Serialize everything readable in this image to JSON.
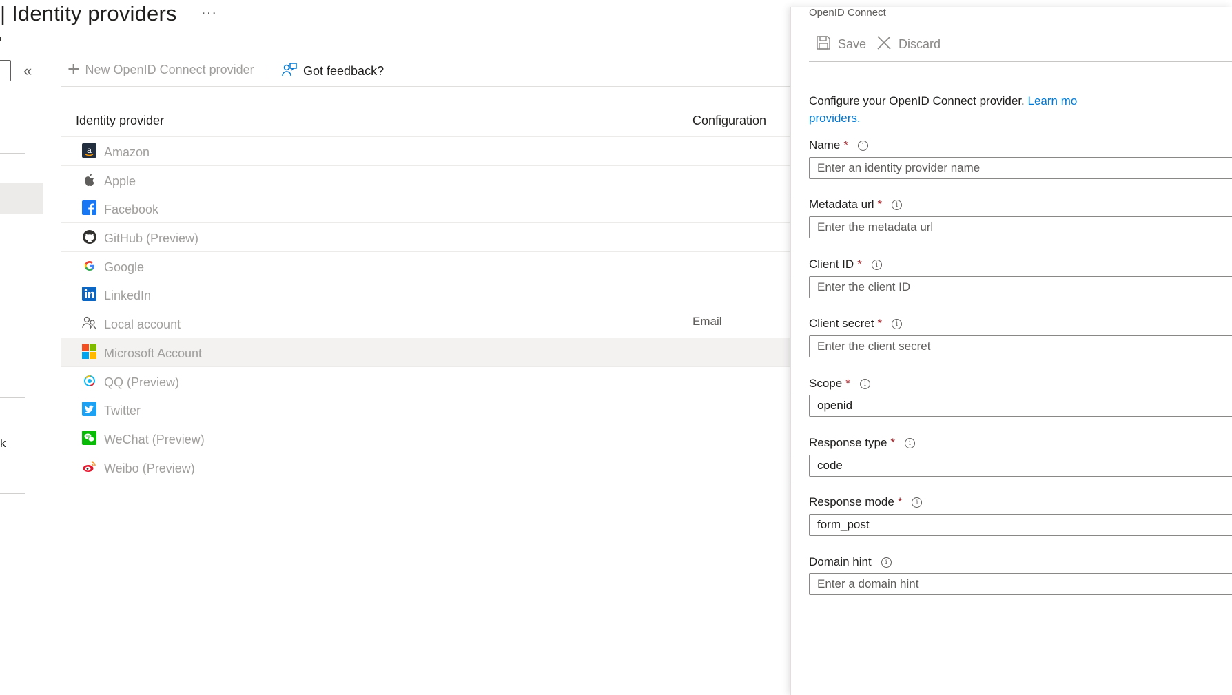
{
  "header": {
    "title": "| Identity providers",
    "more": "···"
  },
  "nav": {
    "collapse": "«",
    "partial_text": "k"
  },
  "commandbar": {
    "new_provider": "New OpenID Connect provider",
    "feedback": "Got feedback?"
  },
  "table": {
    "headers": {
      "provider": "Identity provider",
      "configuration": "Configuration"
    },
    "rows": [
      {
        "name": "Amazon",
        "icon": "amazon-icon",
        "configuration": ""
      },
      {
        "name": "Apple",
        "icon": "apple-icon",
        "configuration": ""
      },
      {
        "name": "Facebook",
        "icon": "facebook-icon",
        "configuration": ""
      },
      {
        "name": "GitHub (Preview)",
        "icon": "github-icon",
        "configuration": ""
      },
      {
        "name": "Google",
        "icon": "google-icon",
        "configuration": ""
      },
      {
        "name": "LinkedIn",
        "icon": "linkedin-icon",
        "configuration": ""
      },
      {
        "name": "Local account",
        "icon": "local-account-icon",
        "configuration": "Email"
      },
      {
        "name": "Microsoft Account",
        "icon": "microsoft-icon",
        "configuration": ""
      },
      {
        "name": "QQ (Preview)",
        "icon": "qq-icon",
        "configuration": ""
      },
      {
        "name": "Twitter",
        "icon": "twitter-icon",
        "configuration": ""
      },
      {
        "name": "WeChat (Preview)",
        "icon": "wechat-icon",
        "configuration": ""
      },
      {
        "name": "Weibo (Preview)",
        "icon": "weibo-icon",
        "configuration": ""
      }
    ]
  },
  "panel": {
    "title": "OpenID Connect",
    "save": "Save",
    "discard": "Discard",
    "intro_text": "Configure your OpenID Connect provider. ",
    "intro_link_1": "Learn mo",
    "intro_link_2": "providers.",
    "fields": {
      "name": {
        "label": "Name",
        "placeholder": "Enter an identity provider name",
        "value": ""
      },
      "metadata_url": {
        "label": "Metadata url",
        "placeholder": "Enter the metadata url",
        "value": ""
      },
      "client_id": {
        "label": "Client ID",
        "placeholder": "Enter the client ID",
        "value": ""
      },
      "client_secret": {
        "label": "Client secret",
        "placeholder": "Enter the client secret",
        "value": ""
      },
      "scope": {
        "label": "Scope",
        "placeholder": "",
        "value": "openid"
      },
      "response_type": {
        "label": "Response type",
        "placeholder": "",
        "value": "code"
      },
      "response_mode": {
        "label": "Response mode",
        "placeholder": "",
        "value": "form_post"
      },
      "domain_hint": {
        "label": "Domain hint",
        "placeholder": "Enter a domain hint",
        "value": ""
      }
    },
    "required_mark": "*",
    "info_glyph": "i"
  },
  "colors": {
    "accent": "#0078d4",
    "required": "#a4262c",
    "selected_row": "#f3f2f1"
  }
}
